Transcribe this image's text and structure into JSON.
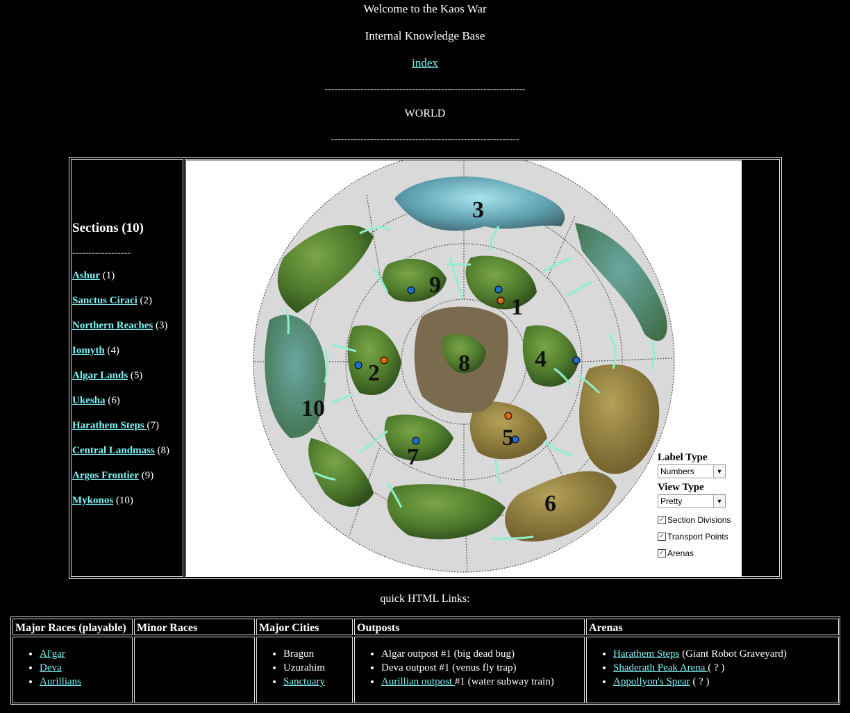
{
  "header": {
    "welcome": "Welcome to the Kaos War",
    "subtitle": "Internal Knowledge Base",
    "index_link": "index",
    "divider_top": "--------------------------------------------------------------",
    "page_title": "WORLD",
    "divider_bottom": "----------------------------------------------------------"
  },
  "sections": {
    "heading": "Sections (10)",
    "divider": "------------------",
    "items": [
      {
        "name": "Ashur",
        "count": "(1)"
      },
      {
        "name": "Sanctus Ciraci",
        "count": "(2)"
      },
      {
        "name": "Northern Reaches",
        "count": "(3)"
      },
      {
        "name": "Iomyth",
        "count": "(4)"
      },
      {
        "name": "Algar Lands",
        "count": "(5)"
      },
      {
        "name": "Ukesha",
        "count": "(6)"
      },
      {
        "name": "Harathem Steps ",
        "count": "(7)"
      },
      {
        "name": "Central Landmass",
        "count": "(8)"
      },
      {
        "name": "Argos Frontier",
        "count": "(9)"
      },
      {
        "name": "Mykonos",
        "count": "(10)"
      }
    ]
  },
  "map": {
    "region_numbers": [
      "1",
      "2",
      "3",
      "4",
      "5",
      "6",
      "7",
      "8",
      "9",
      "10"
    ],
    "colors": {
      "land_green": "#4f7a2c",
      "land_desert": "#8c7a3a",
      "land_ice": "#6fb6c4",
      "transport_arrow": "#8ef0d0",
      "transport_blue": "#1e6fd0",
      "arena_orange": "#d86a10"
    },
    "controls": {
      "label_type_title": "Label Type",
      "label_type_value": "Numbers",
      "view_type_title": "View Type",
      "view_type_value": "Pretty",
      "checkboxes": [
        {
          "label": "Section Divisions",
          "checked": true
        },
        {
          "label": "Transport Points",
          "checked": true
        },
        {
          "label": "Arenas",
          "checked": true
        }
      ]
    }
  },
  "quick_links": {
    "title": "quick HTML Links:",
    "columns": {
      "major_races": {
        "header": "Major Races (playable)",
        "items": [
          {
            "link": "Al'gar",
            "rest": ""
          },
          {
            "link": "Deva",
            "rest": ""
          },
          {
            "link": "Aurillians",
            "rest": ""
          }
        ]
      },
      "minor_races": {
        "header": "Minor Races",
        "items": []
      },
      "major_cities": {
        "header": "Major Cities",
        "items": [
          {
            "text": "Bragun"
          },
          {
            "text": "Uzurahim"
          },
          {
            "link": "Sanctuary"
          }
        ]
      },
      "outposts": {
        "header": "Outposts",
        "items": [
          {
            "text": "Algar outpost #1 (big dead bug)"
          },
          {
            "text": "Deva outpost #1 (venus fly trap)"
          },
          {
            "link": "Aurillian outpost ",
            "rest": "#1 (water subway train)"
          }
        ]
      },
      "arenas": {
        "header": "Arenas",
        "items": [
          {
            "link": "Harathem Steps",
            "rest": " (Giant Robot Graveyard)"
          },
          {
            "link": "Shaderath Peak Arena ",
            "rest": "( ? )"
          },
          {
            "link": "Appollyon's Spear",
            "rest": " ( ? )"
          }
        ]
      }
    }
  }
}
